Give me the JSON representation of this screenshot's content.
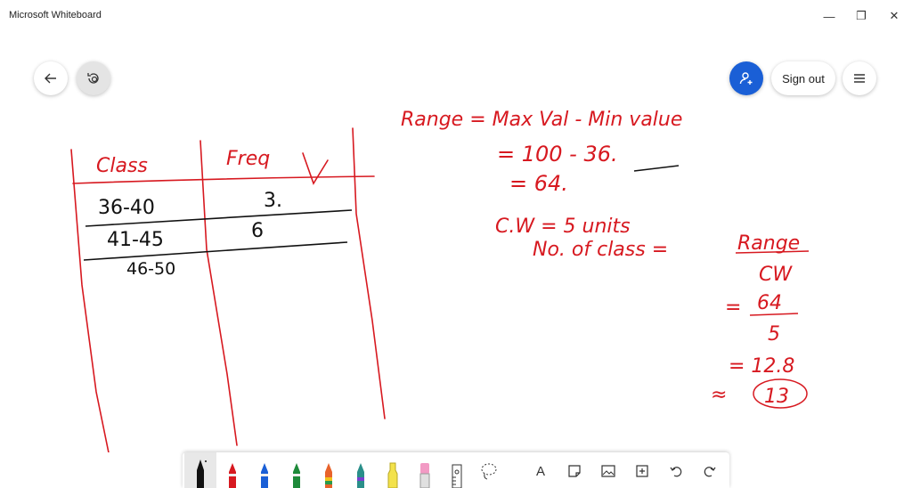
{
  "app": {
    "title": "Microsoft Whiteboard"
  },
  "window_controls": {
    "minimize": "—",
    "restore": "❐",
    "close": "✕"
  },
  "header": {
    "sign_out_label": "Sign out"
  },
  "ink_color": "#d71920",
  "ink_black": "#111111",
  "table": {
    "headers": [
      "Class",
      "Freq"
    ],
    "rows": [
      {
        "class": "36-40",
        "freq": "3."
      },
      {
        "class": "41-45",
        "freq": "6"
      },
      {
        "class": "46-50",
        "freq": ""
      }
    ]
  },
  "notes": {
    "line1": "Range = Max Val - Min value",
    "line2": "= 100 - 36.",
    "line3": "= 64.",
    "line4": "C.W = 5 units",
    "line5_a": "No. of class =",
    "line5_b": "Range",
    "line6": "CW",
    "line7_num": "64",
    "line7_den": "5",
    "line7_eq": "=",
    "line8": "= 12.8",
    "line9_approx": "≈",
    "line9_val": "13"
  },
  "toolbar": {
    "text_icon_label": "A"
  }
}
